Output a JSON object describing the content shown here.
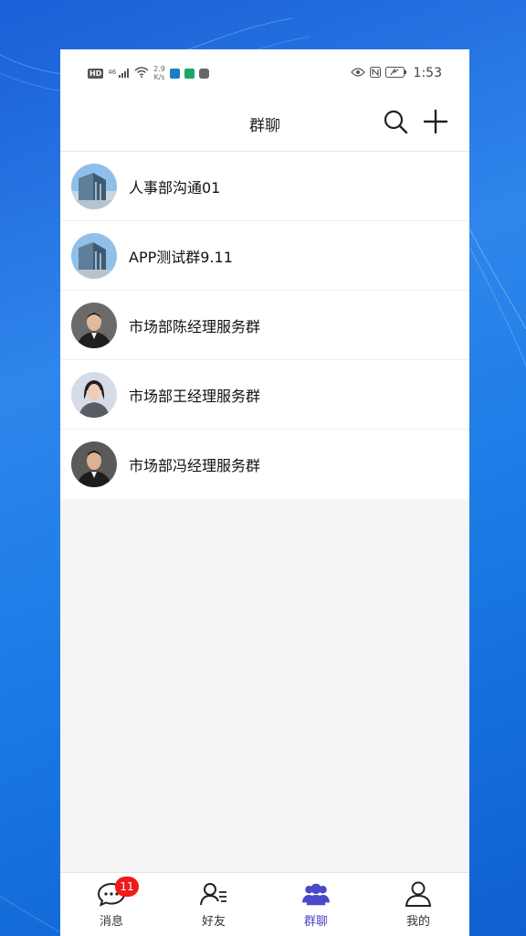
{
  "status_bar": {
    "left_chips": [
      "HD",
      "46"
    ],
    "net_speed_value": "2.9",
    "net_speed_unit": "K/s",
    "time": "1:53"
  },
  "header": {
    "title": "群聊",
    "search_icon": "search-icon",
    "add_icon": "plus-icon"
  },
  "groups": [
    {
      "name": "人事部沟通01",
      "avatar": "building"
    },
    {
      "name": "APP测试群9.11",
      "avatar": "building"
    },
    {
      "name": "市场部陈经理服务群",
      "avatar": "man-suit"
    },
    {
      "name": "市场部王经理服务群",
      "avatar": "woman-suit"
    },
    {
      "name": "市场部冯经理服务群",
      "avatar": "man-suit"
    }
  ],
  "tabbar": {
    "tabs": [
      {
        "label": "消息",
        "icon": "chat-bubble-icon",
        "badge": "11",
        "active": false
      },
      {
        "label": "好友",
        "icon": "contacts-icon",
        "active": false
      },
      {
        "label": "群聊",
        "icon": "group-icon",
        "active": true
      },
      {
        "label": "我的",
        "icon": "person-icon",
        "active": false
      }
    ]
  },
  "colors": {
    "accent": "#4b47c9",
    "badge": "#f01a1a",
    "background": "#f5f5f5"
  }
}
